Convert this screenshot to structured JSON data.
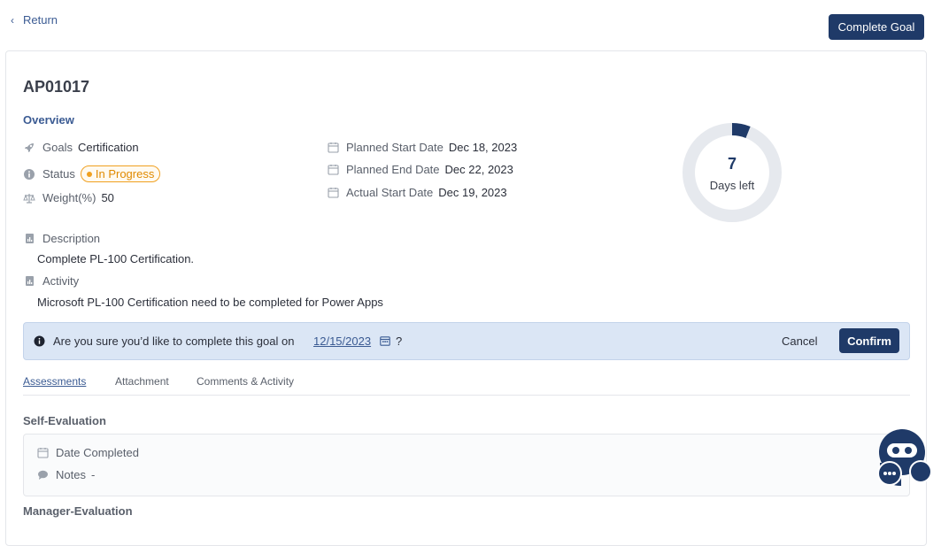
{
  "header": {
    "return_label": "Return",
    "complete_button": "Complete Goal"
  },
  "goal": {
    "id": "AP01017",
    "overview_label": "Overview",
    "goals_label": "Goals",
    "goals_value": "Certification",
    "status_label": "Status",
    "status_value": "In Progress",
    "weight_label": "Weight(%)",
    "weight_value": "50",
    "planned_start_label": "Planned Start Date",
    "planned_start_value": "Dec 18, 2023",
    "planned_end_label": "Planned End Date",
    "planned_end_value": "Dec 22, 2023",
    "actual_start_label": "Actual Start Date",
    "actual_start_value": "Dec 19, 2023",
    "days_left_number": "7",
    "days_left_label": "Days left",
    "days_progress_fraction": 0.06,
    "description_label": "Description",
    "description_value": "Complete PL-100 Certification.",
    "activity_label": "Activity",
    "activity_value": "Microsoft PL-100 Certification need to be completed for Power Apps"
  },
  "confirm_bar": {
    "question": "Are you sure you’d like to complete this goal on",
    "date": "12/15/2023",
    "question_mark": "?",
    "cancel": "Cancel",
    "confirm": "Confirm"
  },
  "tabs": [
    {
      "label": "Assessments",
      "active": true
    },
    {
      "label": "Attachment",
      "active": false
    },
    {
      "label": "Comments & Activity",
      "active": false
    }
  ],
  "self_evaluation": {
    "title": "Self-Evaluation",
    "date_completed_label": "Date Completed",
    "notes_label": "Notes",
    "notes_value": "-"
  },
  "manager_evaluation": {
    "title": "Manager-Evaluation"
  },
  "colors": {
    "primary": "#1f3a68",
    "link": "#3b5b93",
    "status": "#f0a020",
    "confirm_bg": "#dbe6f5"
  }
}
